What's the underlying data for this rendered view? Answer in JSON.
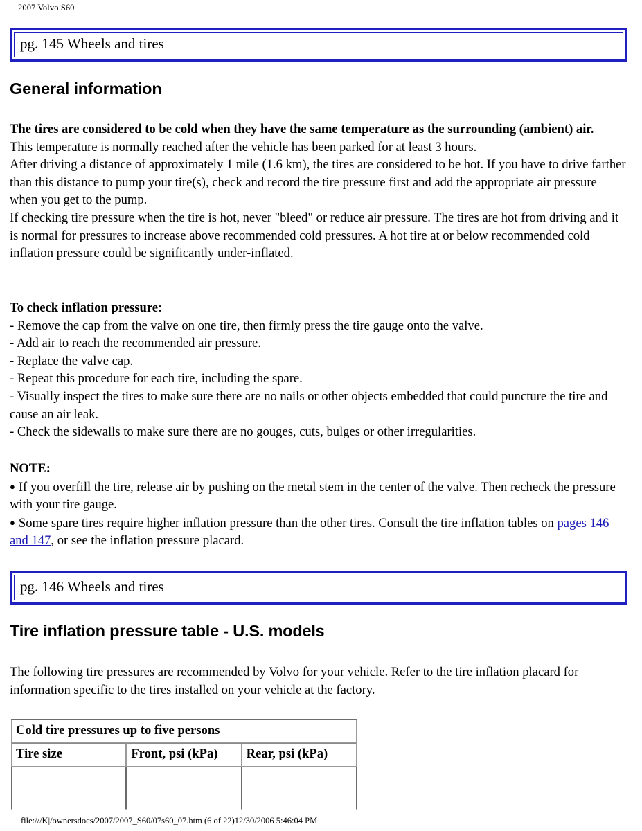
{
  "document": {
    "running_head": "2007 Volvo S60",
    "footer_path": "file:///K|/ownersdocs/2007/2007_S60/07s60_07.htm (6 of 22)12/30/2006 5:46:04 PM",
    "link_color": "#1A1AB4",
    "banner_border_color": "#2020C0"
  },
  "page_145": {
    "banner_label": "pg. 145 Wheels and tires",
    "heading": "General information",
    "lead_bold": "The tires are considered to be cold when they have the same temperature as the surrounding (ambient) air.",
    "paragraph_1": "This temperature is normally reached after the vehicle has been parked for at least 3 hours.",
    "paragraph_2": "After driving a distance of approximately 1 mile (1.6 km), the tires are considered to be hot. If you have to drive farther than this distance to pump your tire(s), check and record the tire pressure first and add the appropriate air pressure when you get to the pump.",
    "paragraph_3": "If checking tire pressure when the tire is hot, never \"bleed\" or reduce air pressure. The tires are hot from driving and it is normal for pressures to increase above recommended cold pressures. A hot tire at or below recommended cold inflation pressure could be significantly under-inflated.",
    "check_heading": "To check inflation pressure:",
    "check_steps": [
      "- Remove the cap from the valve on one tire, then firmly press the tire gauge onto the valve.",
      "- Add air to reach the recommended air pressure.",
      "- Replace the valve cap.",
      "- Repeat this procedure for each tire, including the spare.",
      "- Visually inspect the tires to make sure there are no nails or other objects embedded that could puncture the tire and cause an air leak.",
      "- Check the sidewalls to make sure there are no gouges, cuts, bulges or other irregularities."
    ],
    "note_heading": "NOTE:",
    "note_bullet_1": "If you overfill the tire, release air by pushing on the metal stem in the center of the valve. Then recheck the pressure with your tire gauge.",
    "note_bullet_2_before": "Some spare tires require higher inflation pressure than the other tires. Consult the tire inflation tables on ",
    "note_bullet_2_link": "pages 146 and 147",
    "note_bullet_2_after": ", or see the inflation pressure placard.",
    "bullet_glyph": "●"
  },
  "page_146": {
    "banner_label": "pg. 146 Wheels and tires",
    "heading": "Tire inflation pressure table - U.S. models",
    "intro": "The following tire pressures are recommended by Volvo for your vehicle. Refer to the tire inflation placard for information specific to the tires installed on your vehicle at the factory.",
    "table": {
      "span_header": "Cold tire pressures up to five persons",
      "columns": [
        "Tire size",
        "Front, psi (kPa)",
        "Rear, psi (kPa)"
      ],
      "rows": []
    }
  }
}
